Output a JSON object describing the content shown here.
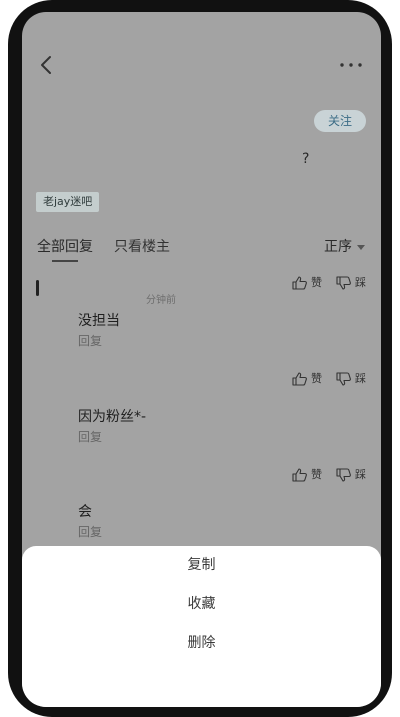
{
  "header": {
    "follow_label": "关注",
    "question_mark": "?",
    "forum_tag": "老jay迷吧"
  },
  "tabs": {
    "all_replies": "全部回复",
    "owner_only": "只看楼主",
    "sort_label": "正序"
  },
  "time_label": "分钟前",
  "reactions": {
    "like_label": "赞",
    "dislike_label": "踩"
  },
  "comments": [
    {
      "text": "没担当",
      "reply_label": "回复"
    },
    {
      "text": "因为粉丝*-",
      "reply_label": "回复"
    },
    {
      "text": "会",
      "reply_label": "回复"
    }
  ],
  "action_sheet": {
    "copy": "复制",
    "favorite": "收藏",
    "delete": "删除"
  },
  "icons": {
    "back": "chevron-left-icon",
    "more": "ellipsis-icon",
    "like": "thumbs-up-icon",
    "dislike": "thumbs-down-icon"
  },
  "colors": {
    "overlay": "#a3a3a3",
    "follow_bg": "#c9d3d6",
    "follow_text": "#3c6d86",
    "sheet_bg": "#ffffff"
  }
}
